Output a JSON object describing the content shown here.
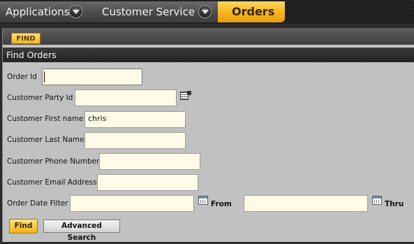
{
  "breadcrumb": {
    "items": [
      {
        "label": "Applications"
      },
      {
        "label": "Customer Service"
      },
      {
        "label": "Orders"
      }
    ]
  },
  "toolbar": {
    "find_tab_label": "FIND"
  },
  "section": {
    "title": "Find Orders"
  },
  "form": {
    "order_id": {
      "label": "Order Id",
      "value": ""
    },
    "customer_party_id": {
      "label": "Customer Party Id",
      "value": ""
    },
    "customer_first_name": {
      "label": "Customer First name",
      "value": "chris"
    },
    "customer_last_name": {
      "label": "Customer Last Name",
      "value": ""
    },
    "customer_phone_number": {
      "label": "Customer Phone Number",
      "value": ""
    },
    "customer_email_address": {
      "label": "Customer Email Address",
      "value": ""
    },
    "order_date_filter": {
      "label": "Order Date Filter",
      "from_value": "",
      "from_label": "From",
      "thru_value": "",
      "thru_label": "Thru"
    }
  },
  "actions": {
    "find_label": "Find",
    "advanced_search_label": "Advanced Search"
  },
  "icons": {
    "breadcrumb_dropdown": "chevron-down-icon",
    "party_lookup": "lookup-icon",
    "date_picker": "calendar-icon"
  },
  "colors": {
    "accent": "#f2b41e",
    "field_background": "#fffbe6",
    "panel_background": "#c1c1c1"
  }
}
